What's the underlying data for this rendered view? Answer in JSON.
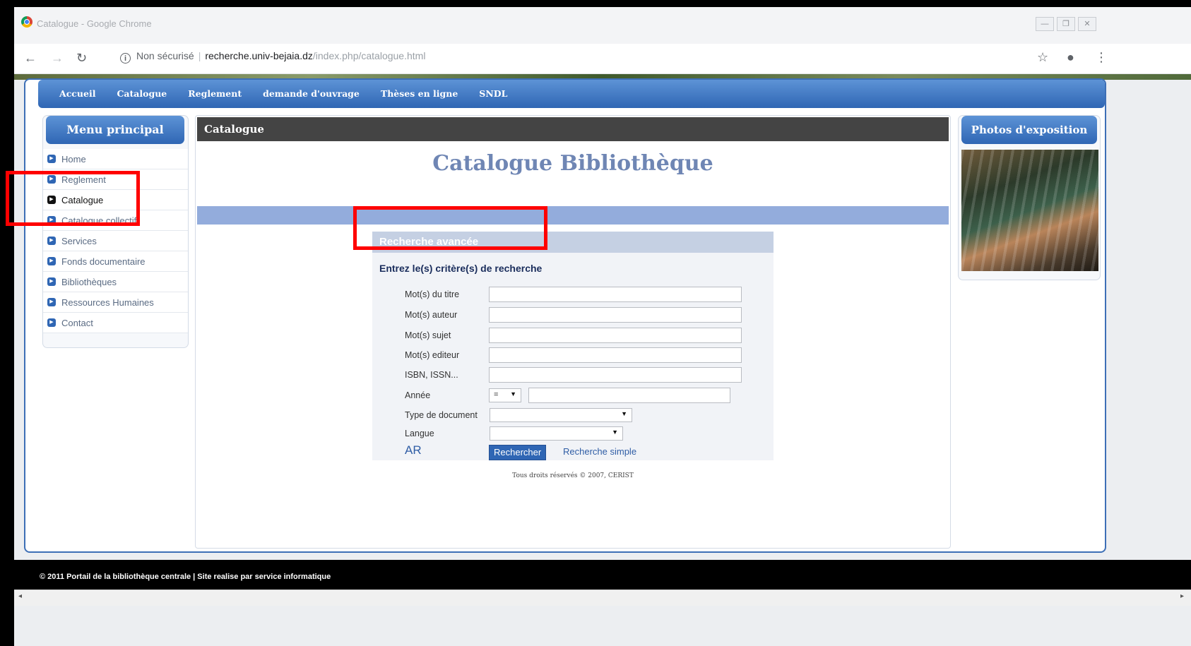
{
  "browser": {
    "window_title": "Catalogue - Google Chrome",
    "security_label": "Non sécurisé",
    "url_host": "recherche.univ-bejaia.dz",
    "url_path": "/index.php/catalogue.html",
    "icons": [
      "back-icon",
      "forward-icon",
      "reload-icon",
      "info-icon",
      "star-icon",
      "account-icon",
      "menu-icon"
    ]
  },
  "top_nav": {
    "items": [
      "Accueil",
      "Catalogue",
      "Reglement",
      "demande d'ouvrage",
      "Thèses en ligne",
      "SNDL"
    ]
  },
  "left_menu": {
    "title": "Menu principal",
    "items": [
      {
        "label": "Home"
      },
      {
        "label": "Reglement"
      },
      {
        "label": "Catalogue"
      },
      {
        "label": "Catalogue collectif"
      },
      {
        "label": "Services"
      },
      {
        "label": "Fonds documentaire"
      },
      {
        "label": "Bibliothèques"
      },
      {
        "label": "Ressources Humaines"
      },
      {
        "label": "Contact"
      }
    ],
    "active": "Catalogue"
  },
  "content": {
    "header": "Catalogue",
    "title": "Catalogue Bibliothèque",
    "search_panel": {
      "title": "Recherche avancée",
      "criteria_title": "Entrez le(s) critère(s) de recherche",
      "fields": {
        "titre": "Mot(s) du titre",
        "auteur": "Mot(s) auteur",
        "sujet": "Mot(s) sujet",
        "editeur": "Mot(s) editeur",
        "isbn": "ISBN, ISSN...",
        "annee": "Année",
        "annee_operator": "=",
        "type_document": "Type de document",
        "langue": "Langue"
      },
      "ar_link": "AR",
      "search_button": "Rechercher",
      "simple_link": "Recherche simple"
    },
    "rights": "Tous droits réservés © 2007, CERIST"
  },
  "right_panel": {
    "title": "Photos d'exposition"
  },
  "footer": {
    "text": "© 2011 Portail de la bibliothèque centrale | Site realise par service informatique"
  },
  "annotation_color": "#ff0000"
}
